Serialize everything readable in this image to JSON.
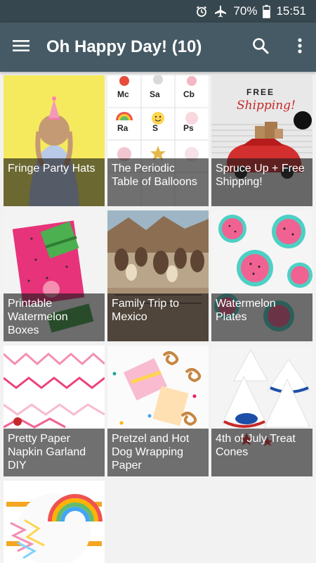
{
  "status_bar": {
    "battery": "70%",
    "time": "15:51",
    "icons": [
      "alarm-icon",
      "airplane-mode-icon",
      "battery-icon"
    ]
  },
  "app_bar": {
    "title": "Oh Happy Day! (10)",
    "icons": [
      "menu-icon",
      "search-icon",
      "more-vert-icon"
    ]
  },
  "posts": [
    {
      "title": "Fringe Party Hats"
    },
    {
      "title": "The Periodic Table of Balloons"
    },
    {
      "title": "Spruce Up + Free Shipping!"
    },
    {
      "title": "Printable Watermelon Boxes"
    },
    {
      "title": "Family Trip to Mexico"
    },
    {
      "title": "Watermelon Plates"
    },
    {
      "title": "Pretty Paper Napkin Garland DIY"
    },
    {
      "title": "Pretzel and Hot Dog Wrapping Paper"
    },
    {
      "title": "4th of July Treat Cones"
    },
    {
      "title": ""
    }
  ],
  "artwork_text": {
    "balloons": [
      "Mc",
      "Sa",
      "Cb",
      "Ra",
      "S",
      "Ps"
    ],
    "free_shipping": [
      "FREE",
      "Shipping!"
    ]
  },
  "colors": {
    "status_bar": "#37474f",
    "app_bar": "#455a64",
    "caption_overlay": "rgba(25,25,25,0.62)"
  }
}
